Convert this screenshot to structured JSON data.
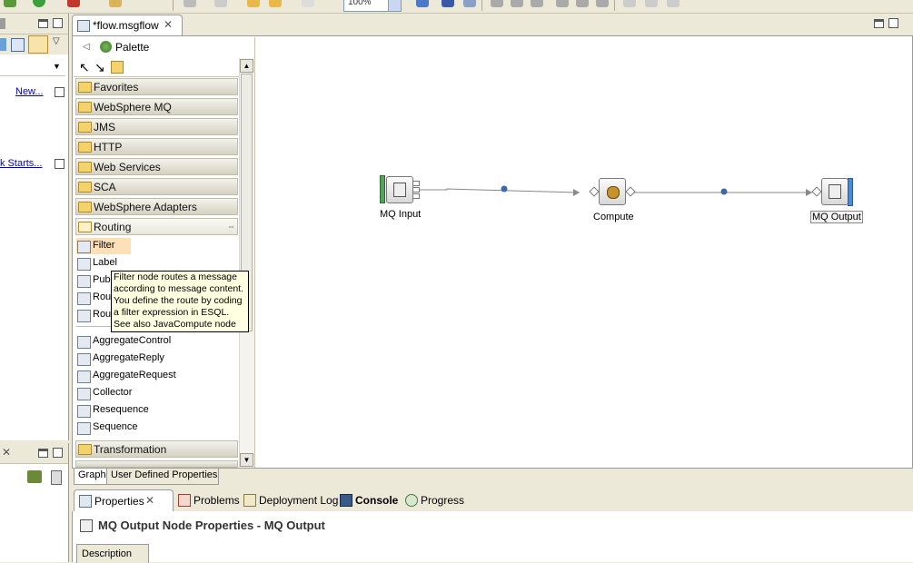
{
  "toolbar": {
    "zoom_value": "100%"
  },
  "left_panel": {
    "new_link": "New...",
    "quick_starts_link": "k Starts..."
  },
  "editor": {
    "tab_title": "*flow.msgflow",
    "tab_close": "✕"
  },
  "palette": {
    "title": "Palette",
    "drawers": [
      {
        "label": "Favorites"
      },
      {
        "label": "WebSphere MQ"
      },
      {
        "label": "JMS"
      },
      {
        "label": "HTTP"
      },
      {
        "label": "Web Services"
      },
      {
        "label": "SCA"
      },
      {
        "label": "WebSphere Adapters"
      },
      {
        "label": "Routing"
      }
    ],
    "routing_items": [
      {
        "label": "Filter",
        "selected": true
      },
      {
        "label": "Label"
      },
      {
        "label": "Publi"
      },
      {
        "label": "Rout"
      },
      {
        "label": "Rout"
      },
      {
        "label": "AggregateControl"
      },
      {
        "label": "AggregateReply"
      },
      {
        "label": "AggregateRequest"
      },
      {
        "label": "Collector"
      },
      {
        "label": "Resequence"
      },
      {
        "label": "Sequence"
      }
    ],
    "bottom_drawers": [
      {
        "label": "Transformation"
      }
    ]
  },
  "tooltip": {
    "lines": [
      "Filter node routes a message",
      "according to message content.",
      "You define the route by coding",
      "a filter expression in ESQL.",
      "See also JavaCompute node"
    ]
  },
  "flow": {
    "nodes": [
      {
        "label": "MQ Input"
      },
      {
        "label": "Compute"
      },
      {
        "label": "MQ Output"
      }
    ]
  },
  "editor_tabs": [
    {
      "label": "Graph",
      "active": true
    },
    {
      "label": "User Defined Properties",
      "active": false
    }
  ],
  "view_tabs": [
    {
      "label": "Properties",
      "active": true,
      "close": "✕"
    },
    {
      "label": "Problems"
    },
    {
      "label": "Deployment Log"
    },
    {
      "label": "Console"
    },
    {
      "label": "Progress"
    }
  ],
  "properties": {
    "title": "MQ Output Node Properties - MQ Output",
    "description_tab": "Description"
  }
}
